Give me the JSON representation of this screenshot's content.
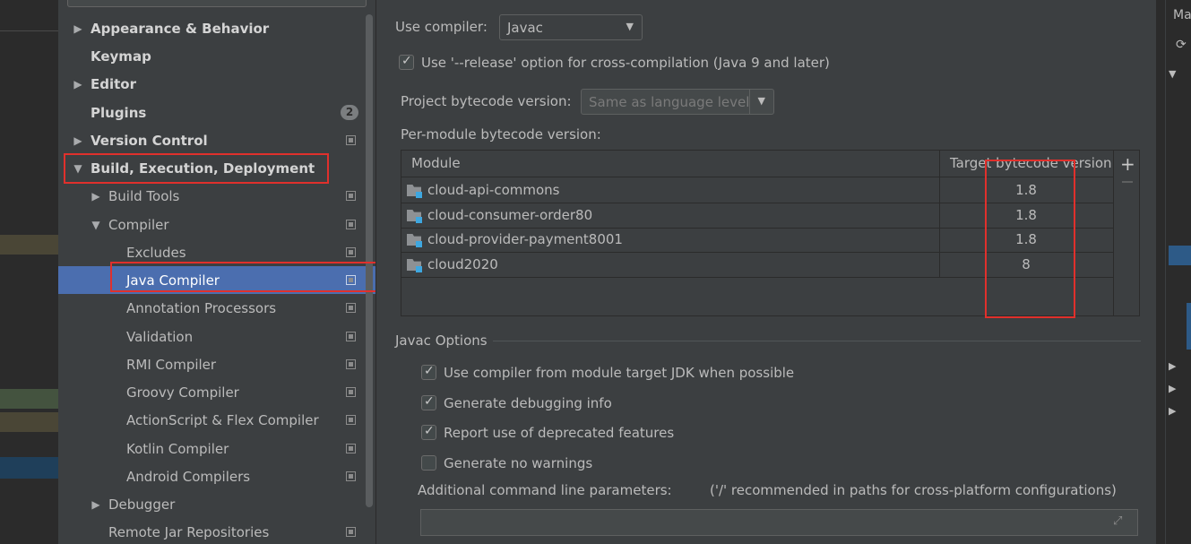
{
  "tree": {
    "items": [
      {
        "label": "Appearance & Behavior",
        "expanded": false
      },
      {
        "label": "Keymap"
      },
      {
        "label": "Editor",
        "expanded": false
      },
      {
        "label": "Plugins",
        "badge": "2"
      },
      {
        "label": "Version Control",
        "expanded": false
      },
      {
        "label": "Build, Execution, Deployment",
        "expanded": true
      },
      {
        "label": "Build Tools",
        "expanded": false
      },
      {
        "label": "Compiler",
        "expanded": true
      },
      {
        "label": "Excludes"
      },
      {
        "label": "Java Compiler",
        "selected": true
      },
      {
        "label": "Annotation Processors"
      },
      {
        "label": "Validation"
      },
      {
        "label": "RMI Compiler"
      },
      {
        "label": "Groovy Compiler"
      },
      {
        "label": "ActionScript & Flex Compiler"
      },
      {
        "label": "Kotlin Compiler"
      },
      {
        "label": "Android Compilers"
      },
      {
        "label": "Debugger",
        "expanded": false
      },
      {
        "label": "Remote Jar Repositories"
      }
    ]
  },
  "compiler": {
    "use_compiler_label": "Use compiler:",
    "use_compiler_value": "Javac",
    "release_option_label": "Use '--release' option for cross-compilation (Java 9 and later)",
    "release_option_checked": true,
    "project_bytecode_label": "Project bytecode version:",
    "project_bytecode_value": "Same as language level",
    "per_module_label": "Per-module bytecode version:"
  },
  "table": {
    "columns": [
      "Module",
      "Target bytecode version"
    ],
    "rows": [
      {
        "module": "cloud-api-commons",
        "target": "1.8"
      },
      {
        "module": "cloud-consumer-order80",
        "target": "1.8"
      },
      {
        "module": "cloud-provider-payment8001",
        "target": "1.8"
      },
      {
        "module": "cloud2020",
        "target": "8"
      }
    ],
    "add_symbol": "+"
  },
  "javac": {
    "section_title": "Javac Options",
    "options": [
      {
        "label": "Use compiler from module target JDK when possible",
        "checked": true
      },
      {
        "label": "Generate debugging info",
        "checked": true
      },
      {
        "label": "Report use of deprecated features",
        "checked": true
      },
      {
        "label": "Generate no warnings",
        "checked": false
      }
    ],
    "additional_label": "Additional command line parameters:",
    "additional_hint": "('/' recommended in paths for cross-platform configurations)",
    "additional_value": ""
  },
  "right_edge": {
    "tab_label": "Ma"
  },
  "colors": {
    "selection": "#4b6eaf",
    "highlight_box": "#e0302c",
    "background": "#3c3f41"
  }
}
